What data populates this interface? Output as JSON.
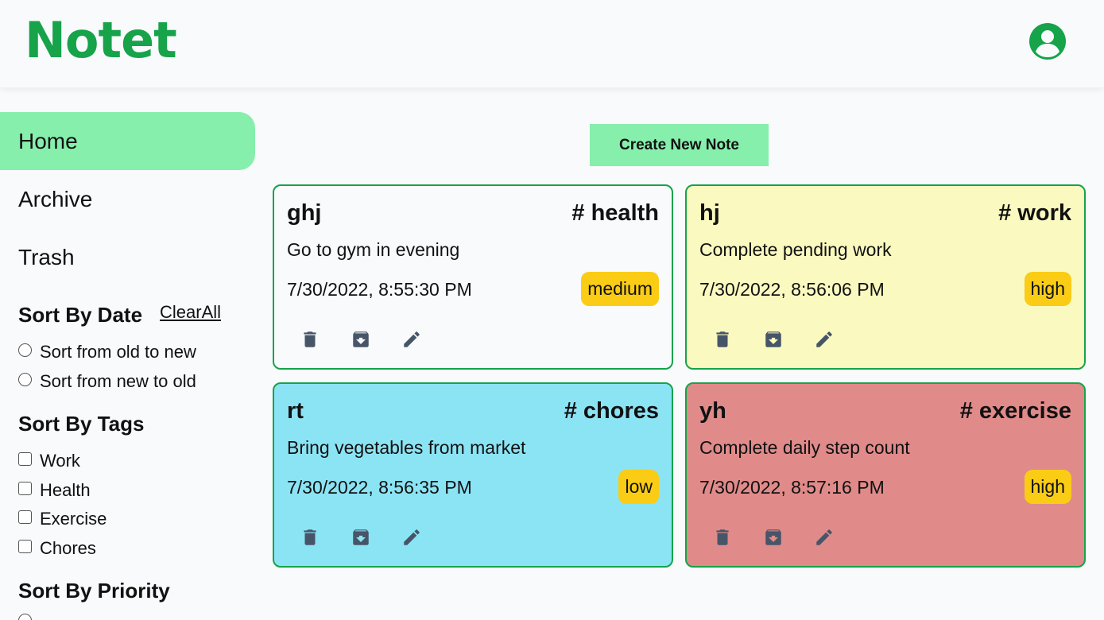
{
  "header": {
    "logo": "Notet",
    "avatar_icon": "account-circle-icon"
  },
  "sidebar": {
    "nav": [
      {
        "label": "Home",
        "active": true
      },
      {
        "label": "Archive",
        "active": false
      },
      {
        "label": "Trash",
        "active": false
      }
    ],
    "sort_by_date": {
      "title": "Sort By Date",
      "clear_all": "ClearAll",
      "options": [
        "Sort from old to new",
        "Sort from new to old"
      ]
    },
    "sort_by_tags": {
      "title": "Sort By Tags",
      "options": [
        "Work",
        "Health",
        "Exercise",
        "Chores"
      ]
    },
    "sort_by_priority": {
      "title": "Sort By Priority"
    }
  },
  "main": {
    "create_button": "Create New Note",
    "notes": [
      {
        "title": "ghj",
        "tag": "# health",
        "text": "Go to gym in evening",
        "date": "7/30/2022, 8:55:30 PM",
        "priority": "medium",
        "color": "#f8fafc"
      },
      {
        "title": "hj",
        "tag": "# work",
        "text": "Complete pending work",
        "date": "7/30/2022, 8:56:06 PM",
        "priority": "high",
        "color": "#fafac0"
      },
      {
        "title": "rt",
        "tag": "# chores",
        "text": "Bring vegetables from market",
        "date": "7/30/2022, 8:56:35 PM",
        "priority": "low",
        "color": "#8be4f4"
      },
      {
        "title": "yh",
        "tag": "# exercise",
        "text": "Complete daily step count",
        "date": "7/30/2022, 8:57:16 PM",
        "priority": "high",
        "color": "#e08a8a"
      }
    ]
  },
  "colors": {
    "brand": "#16a34a",
    "active_nav": "#86efac",
    "priority_badge": "#facc15",
    "icon": "#475569"
  }
}
